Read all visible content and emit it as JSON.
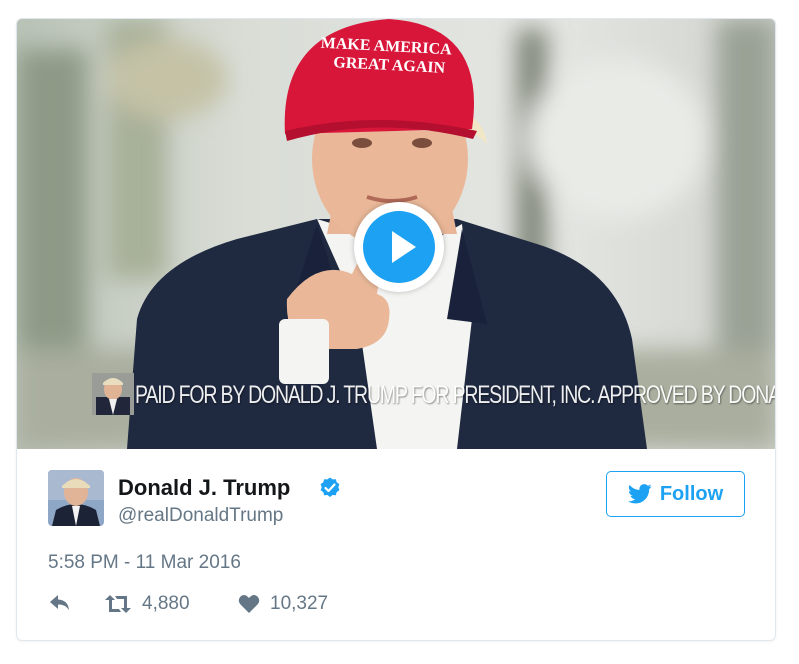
{
  "media": {
    "cap_text": "MAKE AMERICA GREAT AGAIN",
    "cap_line1": "MAKE AMERICA",
    "cap_line2": "GREAT AGAIN",
    "disclaimer": "PAID FOR BY DONALD J. TRUMP FOR PRESIDENT, INC. APPROVED BY DONALD TRUMP"
  },
  "tweet": {
    "author_name": "Donald J. Trump",
    "author_handle": "@realDonaldTrump",
    "follow_label": "Follow",
    "timestamp": "5:58 PM - 11 Mar 2016",
    "retweets": "4,880",
    "likes": "10,327"
  },
  "icons": [
    "play-icon",
    "verified-icon",
    "twitter-bird-icon",
    "reply-icon",
    "retweet-icon",
    "heart-icon"
  ],
  "colors": {
    "accent": "#1da1f2",
    "text": "#14171a",
    "muted": "#657786",
    "cap_red": "#d8163a",
    "border": "#e1e8ed"
  }
}
